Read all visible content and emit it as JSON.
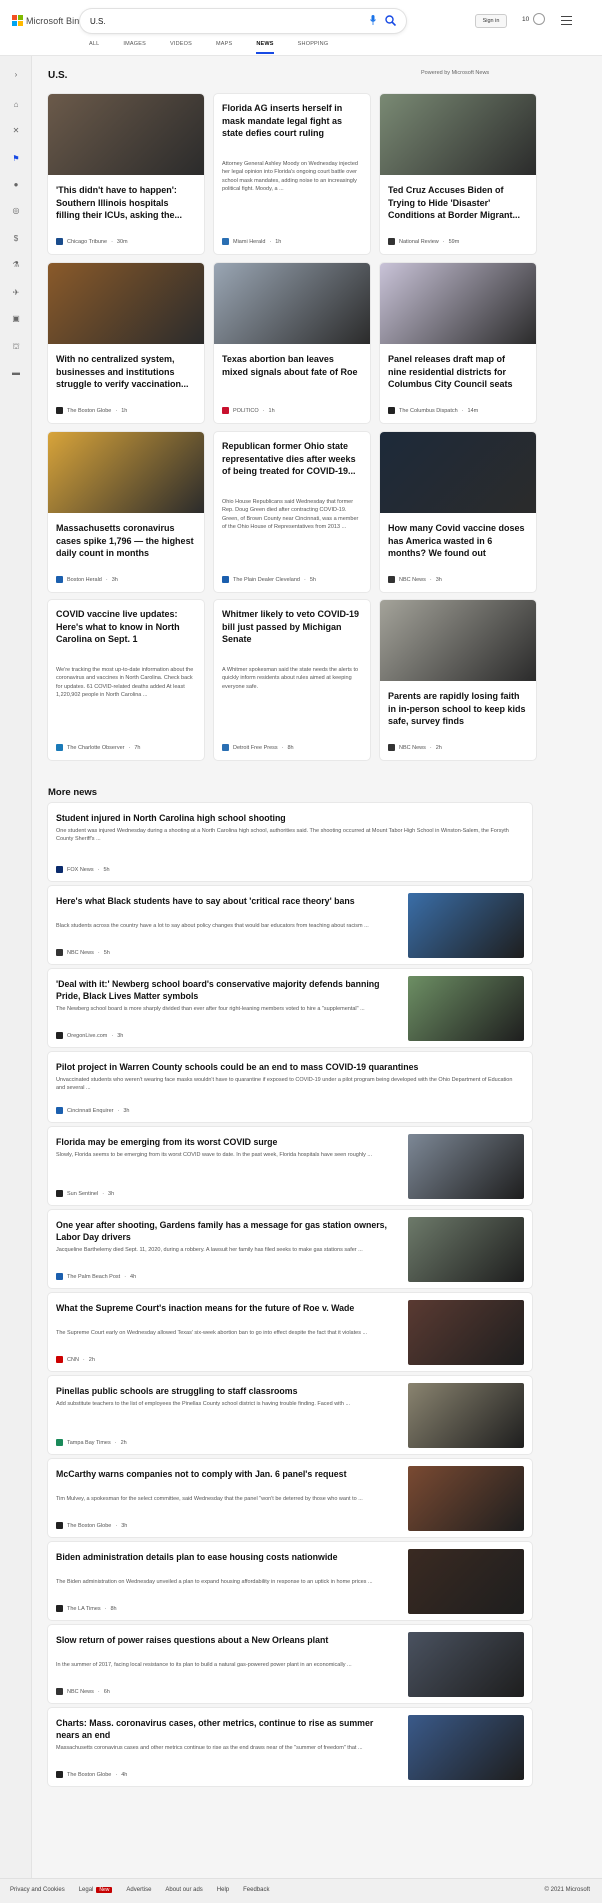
{
  "header": {
    "logo_text": "Microsoft Bing",
    "search_value": "U.S.",
    "signin_label": "Sign in",
    "rewards_count": "10",
    "tabs": [
      {
        "label": "ALL"
      },
      {
        "label": "IMAGES"
      },
      {
        "label": "VIDEOS"
      },
      {
        "label": "MAPS"
      },
      {
        "label": "NEWS"
      },
      {
        "label": "SHOPPING"
      }
    ],
    "active_tab": "NEWS"
  },
  "sidebar": {
    "icons": [
      "expand-icon",
      "home-icon",
      "trending-icon",
      "flag-icon",
      "location-icon",
      "globe-icon",
      "business-icon",
      "science-icon",
      "technology-icon",
      "entertainment-icon",
      "politics-icon",
      "money-icon"
    ]
  },
  "main": {
    "section_title": "U.S.",
    "powered_by": "Powered by Microsoft News",
    "cards": [
      {
        "title": "'This didn't have to happen': Southern Illinois hospitals filling their ICUs, asking the...",
        "snippet": "",
        "source": "Chicago Tribune",
        "time": "30m",
        "has_image": true,
        "image_color": "#6b5a4a",
        "logo_color": "#1a4c8c"
      },
      {
        "title": "Florida AG inserts herself in mask mandate legal fight as state defies court ruling",
        "snippet": "Attorney General Ashley Moody on Wednesday injected her legal opinion into Florida's ongoing court battle over school mask mandates, adding noise to an increasingly political fight. Moody, a ...",
        "source": "Miami Herald",
        "time": "1h",
        "has_image": false,
        "logo_color": "#2a6fb3"
      },
      {
        "title": "Ted Cruz Accuses Biden of Trying to Hide 'Disaster' Conditions at Border Migrant...",
        "snippet": "",
        "source": "National Review",
        "time": "59m",
        "has_image": true,
        "image_color": "#7a8a74",
        "logo_color": "#333333"
      },
      {
        "title": "With no centralized system, businesses and institutions struggle to verify vaccination...",
        "snippet": "",
        "source": "The Boston Globe",
        "time": "1h",
        "has_image": true,
        "image_color": "#8a5a2a",
        "logo_color": "#222222"
      },
      {
        "title": "Texas abortion ban leaves mixed signals about fate of Roe",
        "snippet": "",
        "source": "POLITICO",
        "time": "1h",
        "has_image": true,
        "image_color": "#9aa6b4",
        "logo_color": "#c8102e"
      },
      {
        "title": "Panel releases draft map of nine residential districts for Columbus City Council seats",
        "snippet": "",
        "source": "The Columbus Dispatch",
        "time": "14m",
        "has_image": true,
        "image_color": "#c9c3d8",
        "logo_color": "#222222"
      },
      {
        "title": "Massachusetts coronavirus cases spike 1,796 — the highest daily count in months",
        "snippet": "",
        "source": "Boston Herald",
        "time": "3h",
        "has_image": true,
        "image_color": "#d8a43a",
        "logo_color": "#1b5fae"
      },
      {
        "title": "Republican former Ohio state representative dies after weeks of being treated for COVID-19...",
        "snippet": "Ohio House Republicans said Wednesday that former Rep. Doug Green died after contracting COVID-19. Green, of Brown County near Cincinnati, was a member of the Ohio House of Representatives from 2013 ...",
        "source": "The Plain Dealer Cleveland",
        "time": "5h",
        "has_image": false,
        "logo_color": "#1b5fae"
      },
      {
        "title": "How many Covid vaccine doses has America wasted in 6 months? We found out",
        "snippet": "",
        "source": "NBC News",
        "time": "3h",
        "has_image": true,
        "image_color": "#1d2a3a",
        "logo_color": "#333333"
      },
      {
        "title": "COVID vaccine live updates: Here's what to know in North Carolina on Sept. 1",
        "snippet": "We're tracking the most up-to-date information about the coronavirus and vaccines in North Carolina. Check back for updates. 61 COVID-related deaths added At least 1,220,902 people in North Carolina ...",
        "source": "The Charlotte Observer",
        "time": "7h",
        "has_image": false,
        "logo_color": "#1a7ab8"
      },
      {
        "title": "Whitmer likely to veto COVID-19 bill just passed by Michigan Senate",
        "snippet": "A Whitmer spokesman said the state needs the alerts to quickly inform residents about rules aimed at keeping everyone safe.",
        "source": "Detroit Free Press",
        "time": "8h",
        "has_image": false,
        "logo_color": "#2a6fb3"
      },
      {
        "title": "Parents are rapidly losing faith in in-person school to keep kids safe, survey finds",
        "snippet": "",
        "source": "NBC News",
        "time": "2h",
        "has_image": true,
        "image_color": "#a4a39a",
        "logo_color": "#333333"
      }
    ],
    "more_news_title": "More news",
    "more_news": [
      {
        "title": "Student injured in North Carolina high school shooting",
        "snippet": "One student was injured Wednesday during a shooting at a North Carolina high school, authorities said. The shooting occurred at Mount Tabor High School in Winston-Salem, the Forsyth County Sheriff's ...",
        "source": "FOX News",
        "time": "5h",
        "has_image": false,
        "logo_color": "#0a2a6c"
      },
      {
        "title": "Here's what Black students have to say about 'critical race theory' bans",
        "snippet": "Black students across the country have a lot to say about policy changes that would bar educators from teaching about racism ...",
        "source": "NBC News",
        "time": "5h",
        "has_image": true,
        "image_color": "#3a6ea8",
        "logo_color": "#333333"
      },
      {
        "title": "'Deal with it:' Newberg school board's conservative majority defends banning Pride, Black Lives Matter symbols",
        "snippet": "The Newberg school board is more sharply divided than ever after four right-leaning members voted to hire a \"supplemental\" ...",
        "source": "OregonLive.com",
        "time": "3h",
        "has_image": true,
        "image_color": "#6d8f64",
        "logo_color": "#222222"
      },
      {
        "title": "Pilot project in Warren County schools could be an end to mass COVID-19 quarantines",
        "snippet": "Unvaccinated students who weren't wearing face masks wouldn't have to quarantine if exposed to COVID-19 under a pilot program being developed with the Ohio Department of Education and several ...",
        "source": "Cincinnati Enquirer",
        "time": "3h",
        "has_image": false,
        "logo_color": "#1b5fae"
      },
      {
        "title": "Florida may be emerging from its worst COVID surge",
        "snippet": "Slowly, Florida seems to be emerging from its worst COVID wave to date. In the past week, Florida hospitals have seen roughly ...",
        "source": "Sun Sentinel",
        "time": "3h",
        "has_image": true,
        "image_color": "#7d8896",
        "logo_color": "#222222"
      },
      {
        "title": "One year after shooting, Gardens family has a message for gas station owners, Labor Day drivers",
        "snippet": "Jacqueline Barthelemy died Sept. 11, 2020, during a robbery. A lawsuit her family has filed seeks to make gas stations safer ...",
        "source": "The Palm Beach Post",
        "time": "4h",
        "has_image": true,
        "image_color": "#6d7a6a",
        "logo_color": "#1b5fae"
      },
      {
        "title": "What the Supreme Court's inaction means for the future of Roe v. Wade",
        "snippet": "The Supreme Court early on Wednesday allowed Texas' six-week abortion ban to go into effect despite the fact that it violates ...",
        "source": "CNN",
        "time": "2h",
        "has_image": true,
        "image_color": "#5a3a32",
        "logo_color": "#cc0000"
      },
      {
        "title": "Pinellas public schools are struggling to staff classrooms",
        "snippet": "Add substitute teachers to the list of employees the Pinellas County school district is having trouble finding. Faced with ...",
        "source": "Tampa Bay Times",
        "time": "2h",
        "has_image": true,
        "image_color": "#8a8470",
        "logo_color": "#1a8a5a"
      },
      {
        "title": "McCarthy warns companies not to comply with Jan. 6 panel's request",
        "snippet": "Tim Mulvey, a spokesman for the select committee, said Wednesday that the panel \"won't be deterred by those who want to ...",
        "source": "The Boston Globe",
        "time": "3h",
        "has_image": true,
        "image_color": "#7a4a32",
        "logo_color": "#222222"
      },
      {
        "title": "Biden administration details plan to ease housing costs nationwide",
        "snippet": "The Biden administration on Wednesday unveiled a plan to expand housing affordability in response to an uptick in home prices ...",
        "source": "The LA Times",
        "time": "8h",
        "has_image": true,
        "image_color": "#3a2a22",
        "logo_color": "#222222"
      },
      {
        "title": "Slow return of power raises questions about a New Orleans plant",
        "snippet": "In the summer of 2017, facing local resistance to its plan to build a natural gas-powered power plant in an economically ...",
        "source": "NBC News",
        "time": "6h",
        "has_image": true,
        "image_color": "#4a5260",
        "logo_color": "#333333"
      },
      {
        "title": "Charts: Mass. coronavirus cases, other metrics, continue to rise as summer nears an end",
        "snippet": "Massachusetts coronavirus cases and other metrics continue to rise as the end draws near of the \"summer of freedom\" that ...",
        "source": "The Boston Globe",
        "time": "4h",
        "has_image": true,
        "image_color": "#3a5a8a",
        "logo_color": "#222222"
      }
    ]
  },
  "footer": {
    "links": [
      {
        "label": "Privacy and Cookies"
      },
      {
        "label": "Legal",
        "badge": "New"
      },
      {
        "label": "Advertise"
      },
      {
        "label": "About our ads"
      },
      {
        "label": "Help"
      },
      {
        "label": "Feedback"
      }
    ],
    "copyright": "© 2021 Microsoft"
  },
  "colors": {
    "accent": "#174ae4",
    "badge": "#c50000"
  }
}
